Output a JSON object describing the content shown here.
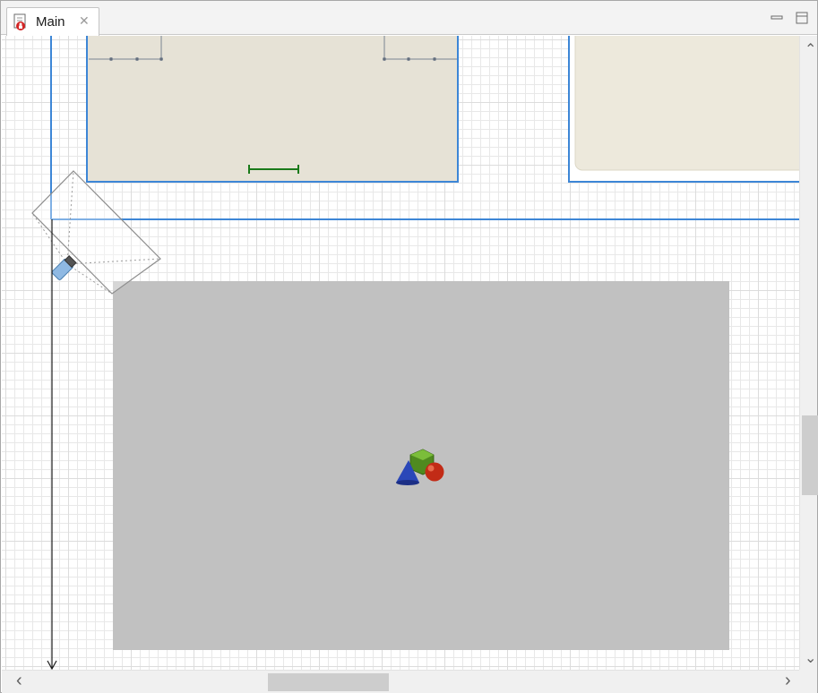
{
  "tab": {
    "label": "Main",
    "icon": "agent-model-icon",
    "close_icon": "close-icon"
  },
  "view_controls": {
    "minimize_icon": "minimize-icon",
    "maximize_icon": "maximize-icon"
  },
  "scrollbars": {
    "up_arrow": "⌃",
    "down_arrow": "⌄",
    "left_arrow": "‹",
    "right_arrow": "›"
  },
  "colors": {
    "room_fill": "#e6e2d6",
    "wall_blue": "#3d86d6",
    "gray_area": "#c1c1c1",
    "measure_green": "#1a7a1a"
  },
  "icons": {
    "camera": "camera-icon",
    "shapes_3d": "3d-shapes-icon"
  }
}
